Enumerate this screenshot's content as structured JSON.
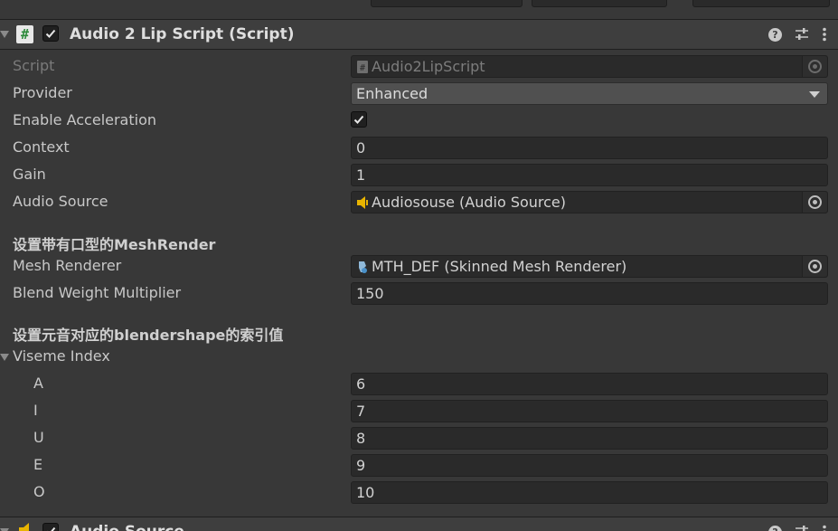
{
  "component": {
    "title": "Audio 2 Lip Script (Script)",
    "enabled": true
  },
  "fields": {
    "script": {
      "label": "Script",
      "value": "Audio2LipScript"
    },
    "provider": {
      "label": "Provider",
      "value": "Enhanced"
    },
    "acceleration": {
      "label": "Enable Acceleration",
      "checked": true
    },
    "context": {
      "label": "Context",
      "value": "0"
    },
    "gain": {
      "label": "Gain",
      "value": "1"
    },
    "audio_source": {
      "label": "Audio Source",
      "value": "Audiosouse (Audio Source)"
    }
  },
  "headers": {
    "mesh": "设置带有口型的MeshRender",
    "viseme": "设置元音对应的blendershape的索引值"
  },
  "mesh": {
    "renderer": {
      "label": "Mesh Renderer",
      "value": "MTH_DEF (Skinned Mesh Renderer)"
    },
    "blend_weight": {
      "label": "Blend Weight Multiplier",
      "value": "150"
    }
  },
  "viseme": {
    "label": "Viseme Index",
    "items": [
      {
        "label": "A",
        "value": "6"
      },
      {
        "label": "I",
        "value": "7"
      },
      {
        "label": "U",
        "value": "8"
      },
      {
        "label": "E",
        "value": "9"
      },
      {
        "label": "O",
        "value": "10"
      }
    ]
  },
  "next_component": {
    "title": "Audio Source"
  },
  "colors": {
    "background": "#383838",
    "field": "#2a2a2a",
    "header": "#3e3e3e",
    "script_icon_green": "#2e8b3c",
    "audio_icon_yellow": "#e8b400"
  }
}
